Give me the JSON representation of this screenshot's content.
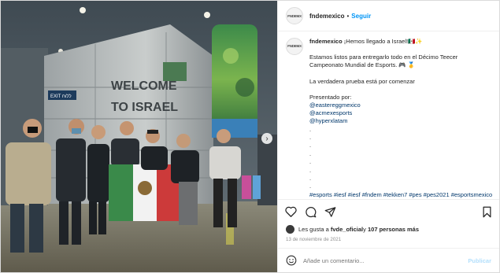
{
  "post": {
    "avatar_text": "FNDEMX",
    "username": "fndemexico",
    "separator": "•",
    "follow_label": "Seguir",
    "photo": {
      "welcome_line1": "WELCOME",
      "welcome_line2": "TO ISRAEL",
      "exit_sign": "EXIT ללוח",
      "flag_emblem": "eagle-emblem"
    },
    "caption": {
      "username": "fndemexico",
      "intro": "¡Hemos llegado a Israel!🇲🇽✨",
      "body": "Estamos listos para entregarlo todo en el Décimo Teecer Campeonato Mundial de Esports. 🎮 🥇",
      "challenge": "La verdadera prueba está por comenzar",
      "presented_by": "Presentado por:",
      "mentions": [
        "@eastereggmexico",
        "@acmexesports",
        "@hyperxlatam"
      ],
      "dots": [
        ".",
        ".",
        ".",
        ".",
        ".",
        ".",
        ".",
        "."
      ],
      "hashtags": "#esports #iesf #iesf #fndem #tekken7 #pes #pes2021 #esportsmexico"
    },
    "actions": {
      "like": "heart-icon",
      "comment": "comment-icon",
      "share": "share-icon",
      "save": "bookmark-icon"
    },
    "likes": {
      "prefix": "Les gusta a ",
      "user": "fvde_oficial",
      "middle": " y ",
      "count": "107 personas más"
    },
    "date": "13 de noviembre de 2021",
    "comment_box": {
      "placeholder": "Añade un comentario...",
      "publish_label": "Publicar"
    },
    "colors": {
      "accent": "#0095f6",
      "link": "#00376b",
      "muted": "#8e8e8e"
    }
  }
}
